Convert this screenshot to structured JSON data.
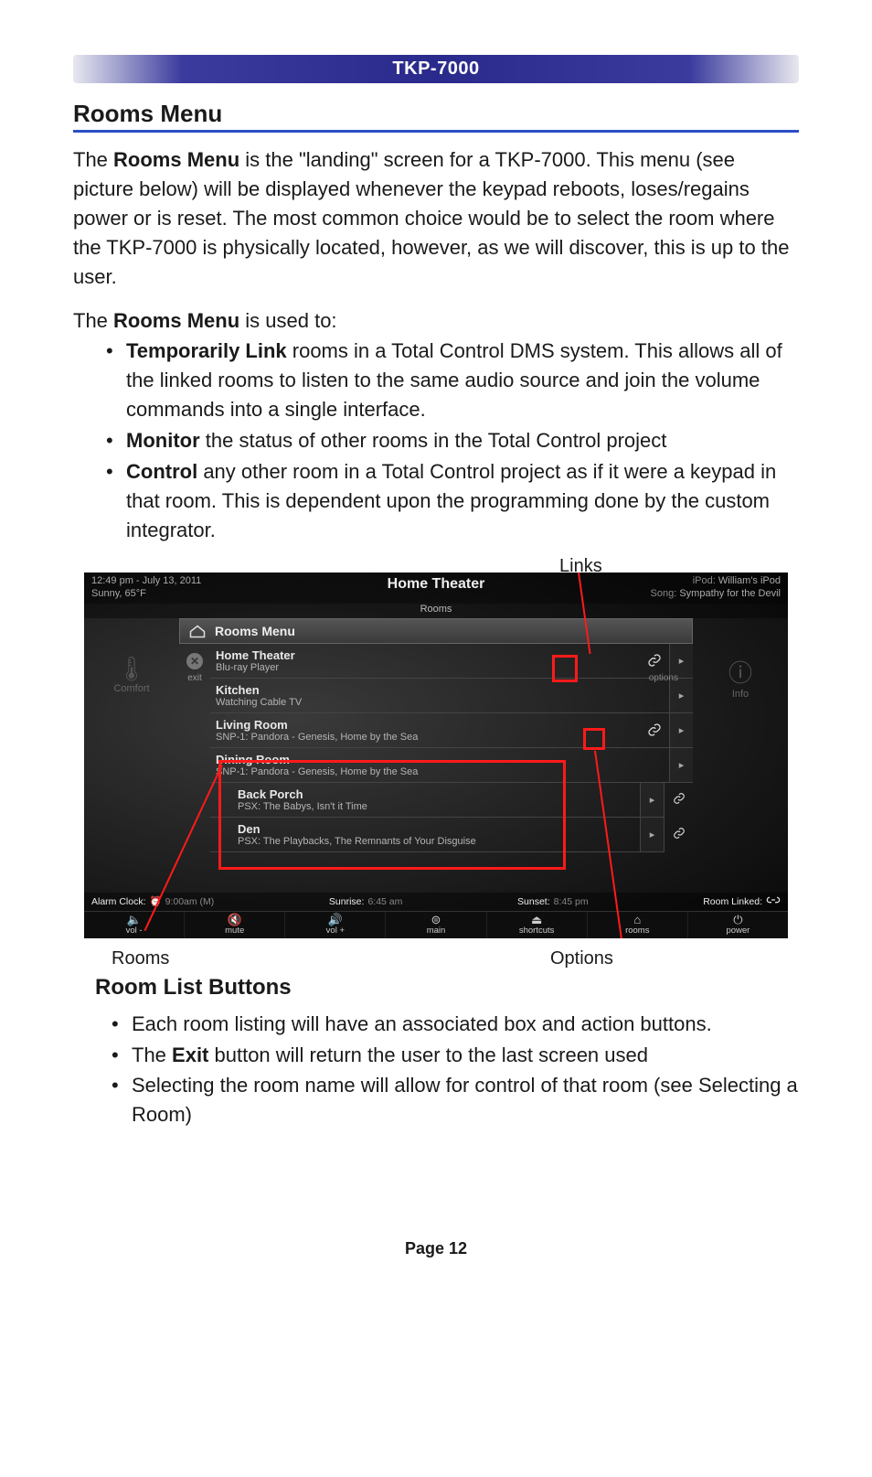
{
  "header": {
    "device": "TKP-7000"
  },
  "section1": {
    "title": "Rooms Menu",
    "para1_pre": "The ",
    "para1_bold": "Rooms Menu",
    "para1_post": " is the \"landing\" screen for a TKP-7000. This menu (see picture below) will be displayed whenever the keypad reboots, loses/regains power or is reset.  The most common choice would be to select the room where the TKP-7000 is physically located, however, as we will discover, this is up to the user.",
    "usedto_pre": "The ",
    "usedto_bold": "Rooms Menu",
    "usedto_post": " is used to:",
    "bullets": [
      {
        "bold": "Temporarily Link",
        "rest": " rooms in a Total Control DMS system. This allows all of the linked rooms to listen to the same audio source and join the volume commands into a single interface."
      },
      {
        "bold": "Monitor",
        "rest": " the status of other rooms in the Total Control project"
      },
      {
        "bold": "Control",
        "rest": " any other room in a Total Control project as if it were a keypad in that room. This is dependent upon the programming done by the custom integrator."
      }
    ]
  },
  "callouts": {
    "links": "Links",
    "rooms": "Rooms",
    "options": "Options"
  },
  "screenshot": {
    "time": "12:49 pm - July 13, 2011",
    "weather": "Sunny, 65°F",
    "title": "Home Theater",
    "tab": "Rooms",
    "ipod_label": "iPod:",
    "ipod_value": "William's iPod",
    "song_label": "Song:",
    "song_value": "Sympathy for the Devil",
    "left_side": {
      "comfort": "Comfort"
    },
    "right_side": {
      "info": "Info"
    },
    "panel_title": "Rooms Menu",
    "options_label": "options",
    "exit_label": "exit",
    "rooms": [
      {
        "name": "Home Theater",
        "status": "Blu-ray Player",
        "link": true,
        "indent": false
      },
      {
        "name": "Kitchen",
        "status": "Watching Cable TV",
        "link": false,
        "indent": false
      },
      {
        "name": "Living Room",
        "status": "SNP-1: Pandora - Genesis, Home by the Sea",
        "link": true,
        "indent": false
      },
      {
        "name": "Dining Room",
        "status": "SNP-1: Pandora - Genesis, Home by the Sea",
        "link": false,
        "indent": false
      },
      {
        "name": "Back Porch",
        "status": "PSX: The Babys, Isn't it Time",
        "link": false,
        "indent": true,
        "groupLink": true
      },
      {
        "name": "Den",
        "status": "PSX: The Playbacks, The Remnants of Your Disguise",
        "link": false,
        "indent": true,
        "groupLink": true
      }
    ],
    "statusbar": {
      "alarm_label": "Alarm Clock:",
      "alarm_value": "9:00am (M)",
      "sunrise_label": "Sunrise:",
      "sunrise_value": "6:45 am",
      "sunset_label": "Sunset:",
      "sunset_value": "8:45 pm",
      "roomlinked": "Room Linked:"
    },
    "bottom": [
      {
        "icon": "🔈",
        "label": "vol -"
      },
      {
        "icon": "🔇",
        "label": "mute"
      },
      {
        "icon": "🔊",
        "label": "vol +"
      },
      {
        "icon": "⊜",
        "label": "main"
      },
      {
        "icon": "⏏",
        "label": "shortcuts"
      },
      {
        "icon": "⌂",
        "label": "rooms"
      },
      {
        "icon": "⏻",
        "label": "power"
      }
    ]
  },
  "section2": {
    "title": "Room List Buttons",
    "bullets": [
      {
        "pre": "Each room listing will have an associated box and action buttons."
      },
      {
        "pre": "The ",
        "bold": "Exit",
        "post": " button will return the user to the last screen used"
      },
      {
        "pre": "Selecting the room name will allow for control of that room (see Selecting a Room)"
      }
    ]
  },
  "footer": {
    "page": "Page 12"
  }
}
